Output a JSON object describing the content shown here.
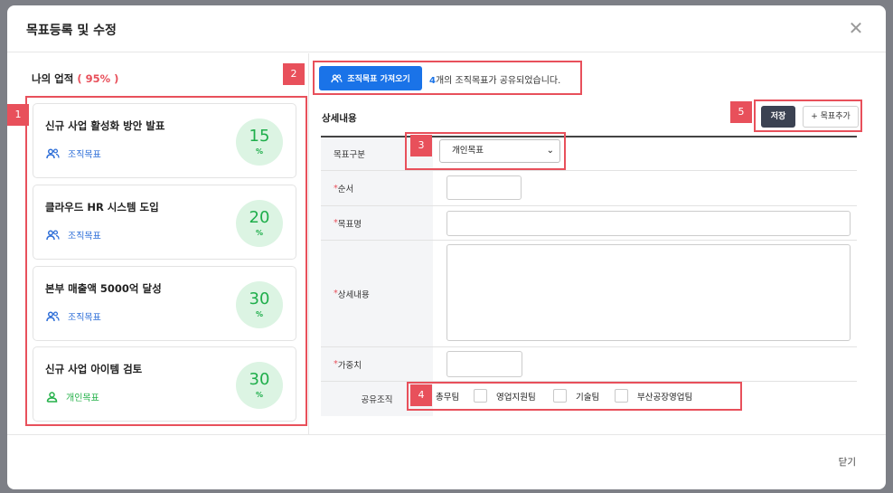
{
  "modal": {
    "title": "목표등록 및 수정",
    "close_label": "닫기"
  },
  "performance": {
    "label": "나의 업적",
    "percent": "( 95% )"
  },
  "goals": [
    {
      "title": "신규 사업 활성화 방안 발표",
      "type": "조직목표",
      "percent": "15",
      "unit": "%"
    },
    {
      "title": "클라우드 HR 시스템 도입",
      "type": "조직목표",
      "percent": "20",
      "unit": "%"
    },
    {
      "title": "본부 매출액 5000억 달성",
      "type": "조직목표",
      "percent": "30",
      "unit": "%"
    },
    {
      "title": "신규 사업 아이템 검토",
      "type": "개인목표",
      "percent": "30",
      "unit": "%"
    }
  ],
  "fetch": {
    "button_label": "조직목표 가져오기",
    "count": "4",
    "info_text": "개의 조직목표가 공유되었습니다."
  },
  "detail": {
    "title": "상세내용",
    "save_label": "저장",
    "add_label": "+ 목표추가"
  },
  "form": {
    "goal_category_label": "목표구분",
    "goal_category_value": "개인목표",
    "order_label": "순서",
    "goal_name_label": "목표명",
    "detail_label": "상세내용",
    "weight_label": "가중치",
    "share_org_label": "공유조직",
    "required_mark": "*",
    "orgs": [
      "총무팀",
      "영업지원팀",
      "기술팀",
      "부산공장영업팀"
    ]
  },
  "badges": [
    "1",
    "2",
    "3",
    "4",
    "5"
  ],
  "colors": {
    "highlight": "#e8505b",
    "primary": "#1a73e8",
    "org_goal": "#2f6fd8",
    "personal_goal": "#25b14a",
    "progress_bg": "#dcf4e3",
    "save_btn": "#3b4252"
  },
  "icons": {
    "org_goal": "users-icon",
    "personal_goal": "user-icon",
    "close": "close-icon",
    "select": "chevron-down-icon"
  }
}
